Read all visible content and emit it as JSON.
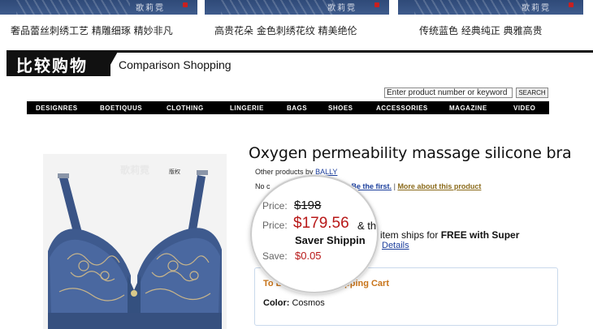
{
  "thumbnails": [
    {
      "caption": "奢品蕾丝刺绣工艺  精雕细琢  精妙非凡",
      "watermark": "歌莉霓"
    },
    {
      "caption": "高贵花朵  金色刺绣花纹  精美绝伦",
      "watermark": "歌莉霓"
    },
    {
      "caption": "传统蓝色  经典纯正  典雅高贵",
      "watermark": "歌莉霓"
    }
  ],
  "section": {
    "title_zh": "比较购物",
    "title_en": "Comparison Shopping"
  },
  "search": {
    "placeholder": "Enter product number or keyword",
    "button": "SEARCH"
  },
  "nav": [
    "DESIGNRES",
    "BOETIQUUS",
    "CLOTHING",
    "LINGERIE",
    "BAGS",
    "SHOES",
    "ACCESSORIES",
    "MAGAZINE",
    "VIDEO"
  ],
  "product": {
    "title": "Oxygen permeability massage silicone bra",
    "other_prefix": "Other products by",
    "brand": "BALLY",
    "row2_start": "No c",
    "be_first": "Be the first.",
    "separator": "|",
    "more_about": "More about this product",
    "price_label": "Price:",
    "list_price": "$198",
    "sale_label": "Price:",
    "sale_price": "$179.56",
    "sale_suffix": "& th",
    "saver": "Saver Shippin",
    "save_label": "Save:",
    "save_value": "$0.05",
    "ships_text": "item ships for ",
    "ships_bold": "FREE with Super",
    "details": "Details",
    "to_buy": "To Buy, Add to Shopping Cart",
    "color_label": "Color:",
    "color_value": "Cosmos",
    "photo_watermark": "歌莉霓",
    "photo_watermark_small": "版权"
  },
  "colors": {
    "accent_red": "#b81818",
    "link_blue": "#1b3e9c",
    "orange": "#c8741a",
    "bra_blue": "#3e5a8e"
  }
}
